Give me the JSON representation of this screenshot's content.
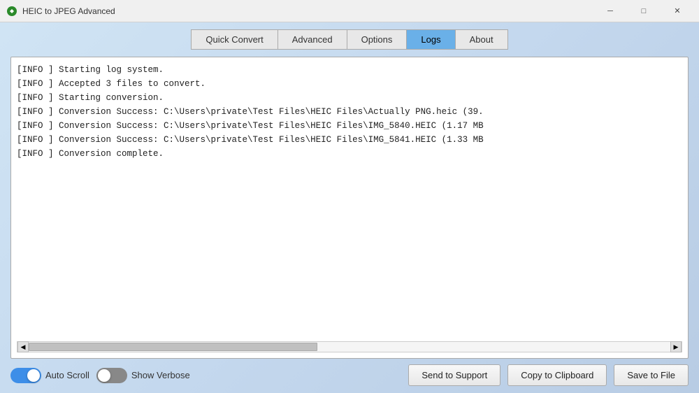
{
  "window": {
    "title": "HEIC to JPEG Advanced",
    "min_label": "─",
    "max_label": "□",
    "close_label": "✕"
  },
  "tabs": [
    {
      "id": "quick-convert",
      "label": "Quick Convert",
      "active": false
    },
    {
      "id": "advanced",
      "label": "Advanced",
      "active": false
    },
    {
      "id": "options",
      "label": "Options",
      "active": false
    },
    {
      "id": "logs",
      "label": "Logs",
      "active": true
    },
    {
      "id": "about",
      "label": "About",
      "active": false
    }
  ],
  "log": {
    "lines": [
      "[INFO   ] Starting log system.",
      "[INFO   ] Accepted 3 files to convert.",
      "[INFO   ] Starting conversion.",
      "[INFO   ] Conversion Success: C:\\Users\\private\\Test Files\\HEIC Files\\Actually PNG.heic (39.",
      "[INFO   ] Conversion Success: C:\\Users\\private\\Test Files\\HEIC Files\\IMG_5840.HEIC (1.17 MB",
      "[INFO   ] Conversion Success: C:\\Users\\private\\Test Files\\HEIC Files\\IMG_5841.HEIC (1.33 MB",
      "[INFO   ] Conversion complete."
    ]
  },
  "controls": {
    "auto_scroll_label": "Auto Scroll",
    "show_verbose_label": "Show Verbose",
    "auto_scroll_on": true,
    "show_verbose_on": false,
    "send_to_support": "Send to Support",
    "copy_to_clipboard": "Copy to Clipboard",
    "save_to_file": "Save to File"
  }
}
